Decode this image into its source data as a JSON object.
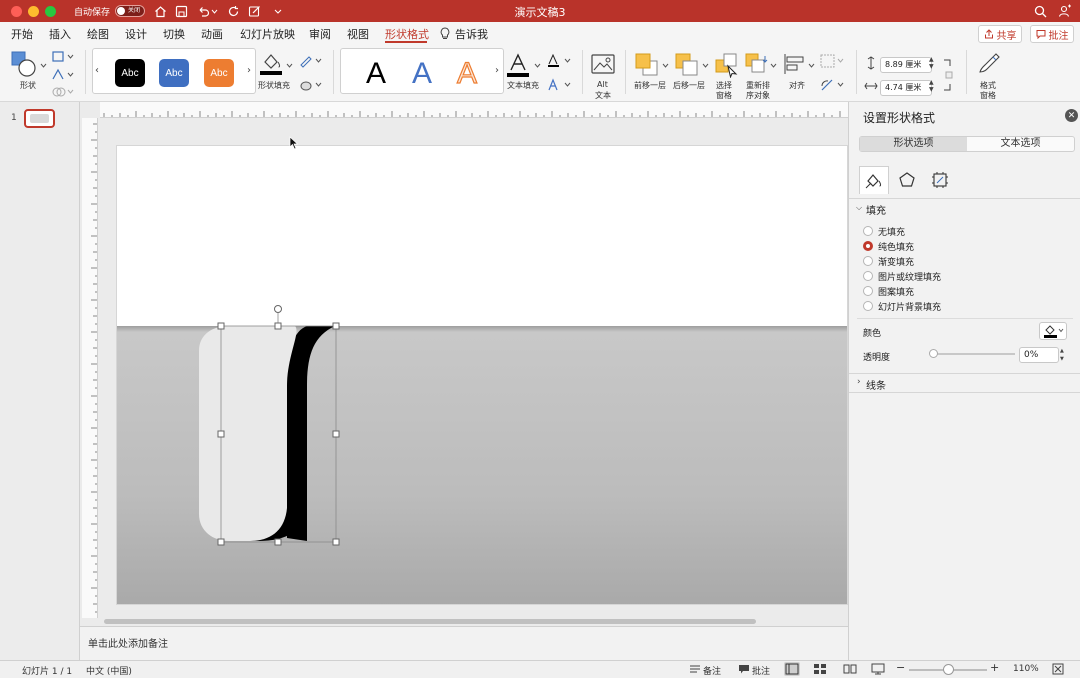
{
  "titlebar": {
    "autosave_label": "自动保存",
    "autosave_state": "关闭",
    "doc_title": "演示文稿3"
  },
  "tabs": [
    {
      "label": "开始"
    },
    {
      "label": "插入"
    },
    {
      "label": "绘图"
    },
    {
      "label": "设计"
    },
    {
      "label": "切换"
    },
    {
      "label": "动画"
    },
    {
      "label": "幻灯片放映"
    },
    {
      "label": "审阅"
    },
    {
      "label": "视图"
    },
    {
      "label": "形状格式",
      "active": true
    },
    {
      "label": "告诉我"
    }
  ],
  "share_label": "共享",
  "comments_label": "批注",
  "ribbon": {
    "shape_label": "形状",
    "style_swatches": [
      {
        "text": "Abc",
        "color": "#000000"
      },
      {
        "text": "Abc",
        "color": "#3f6fc1"
      },
      {
        "text": "Abc",
        "color": "#ed7d31"
      }
    ],
    "shape_fill_label": "形状填充",
    "wordart": [
      {
        "text": "A",
        "style": "black"
      },
      {
        "text": "A",
        "style": "blue"
      },
      {
        "text": "A",
        "style": "orange-outline"
      }
    ],
    "text_fill_label": "文本填充",
    "alt_text_label": [
      "Alt",
      "文本"
    ],
    "bring_forward_label": "前移一层",
    "send_backward_label": "后移一层",
    "selection_pane_label": [
      "选择",
      "窗格"
    ],
    "reorder_label": [
      "重新排",
      "序对象"
    ],
    "align_label": "对齐",
    "height_value": "8.89 厘米",
    "width_value": "4.74 厘米",
    "format_pane_label": [
      "格式",
      "窗格"
    ]
  },
  "slide_number": "1",
  "notes_placeholder": "单击此处添加备注",
  "pane": {
    "title": "设置形状格式",
    "tabs": [
      "形状选项",
      "文本选项"
    ],
    "fill_section": "填充",
    "fill_options": [
      {
        "label": "无填充",
        "selected": false
      },
      {
        "label": "纯色填充",
        "selected": true
      },
      {
        "label": "渐变填充",
        "selected": false
      },
      {
        "label": "图片或纹理填充",
        "selected": false
      },
      {
        "label": "图案填充",
        "selected": false
      },
      {
        "label": "幻灯片背景填充",
        "selected": false
      }
    ],
    "color_label": "颜色",
    "transparency_label": "透明度",
    "transparency_value": "0%",
    "line_section": "线条"
  },
  "status": {
    "slide_info": "幻灯片 1 / 1",
    "language": "中文 (中国)",
    "notes_label": "备注",
    "comments_label": "批注",
    "zoom": "110%",
    "zoom_fraction": 0.5
  },
  "colors": {
    "accent": "#c0392b",
    "titlebar": "#b9332a"
  }
}
